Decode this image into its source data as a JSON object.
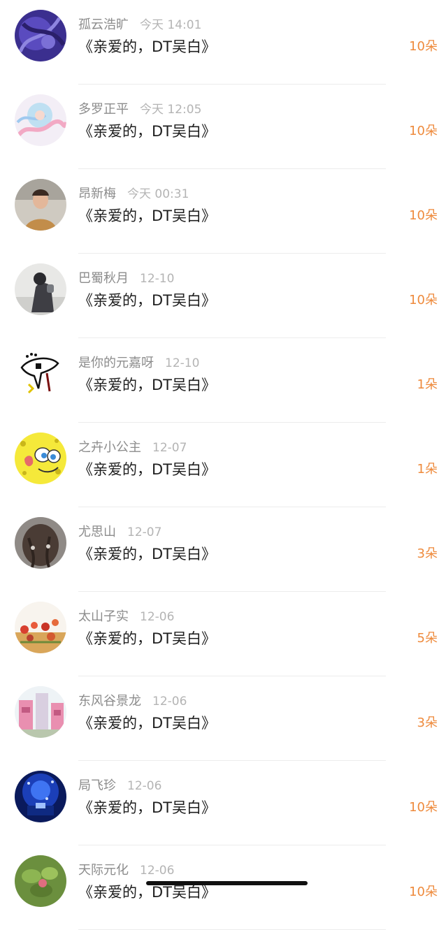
{
  "gift_list": {
    "items": [
      {
        "name": "孤云浩旷",
        "time": "今天 14:01",
        "title": "《亲爱的，DT吴白》",
        "count": "10朵",
        "avatar": "purple-abstract-avatar"
      },
      {
        "name": "多罗正平",
        "time": "今天 12:05",
        "title": "《亲爱的，DT吴白》",
        "count": "10朵",
        "avatar": "anime-girl-avatar"
      },
      {
        "name": "昂新梅",
        "time": "今天 00:31",
        "title": "《亲爱的，DT吴白》",
        "count": "10朵",
        "avatar": "man-portrait-avatar"
      },
      {
        "name": "巴蜀秋月",
        "time": "12-10",
        "title": "《亲爱的，DT吴白》",
        "count": "10朵",
        "avatar": "person-photo-avatar"
      },
      {
        "name": "是你的元嘉呀",
        "time": "12-10",
        "title": "《亲爱的，DT吴白》",
        "count": "1朵",
        "avatar": "cartoon-bird-avatar"
      },
      {
        "name": "之卉小公主",
        "time": "12-07",
        "title": "《亲爱的，DT吴白》",
        "count": "1朵",
        "avatar": "sponge-cartoon-avatar"
      },
      {
        "name": "尤思山",
        "time": "12-07",
        "title": "《亲爱的，DT吴白》",
        "count": "3朵",
        "avatar": "hair-back-avatar"
      },
      {
        "name": "太山子实",
        "time": "12-06",
        "title": "《亲爱的，DT吴白》",
        "count": "5朵",
        "avatar": "flower-field-avatar"
      },
      {
        "name": "东风谷景龙",
        "time": "12-06",
        "title": "《亲爱的，DT吴白》",
        "count": "3朵",
        "avatar": "pink-building-avatar"
      },
      {
        "name": "局飞珍",
        "time": "12-06",
        "title": "《亲爱的，DT吴白》",
        "count": "10朵",
        "avatar": "blue-lights-avatar"
      },
      {
        "name": "天际元化",
        "time": "12-06",
        "title": "《亲爱的，DT吴白》",
        "count": "10朵",
        "avatar": "green-plant-avatar"
      }
    ]
  },
  "colors": {
    "count_accent": "#ee8a3c",
    "name": "#8c8c8c",
    "time": "#b4b4b4",
    "title": "#1e1e1e"
  }
}
